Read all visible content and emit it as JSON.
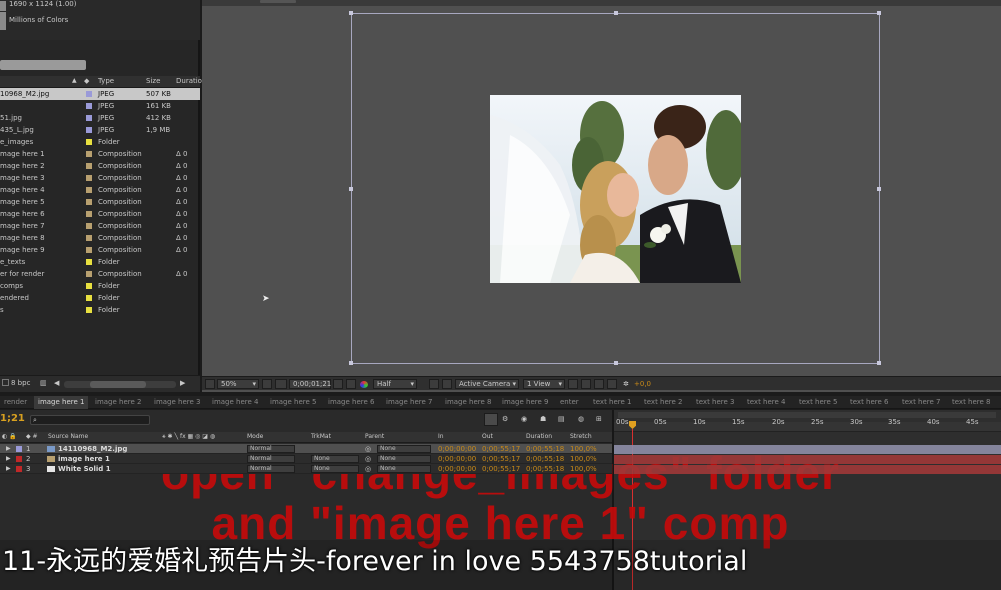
{
  "project": {
    "info": {
      "dimensions": "1690 x 1124 (1.00)",
      "colors": "Millions of Colors"
    },
    "columns": {
      "type": "Type",
      "size": "Size",
      "duration": "Duration"
    },
    "items": [
      {
        "name": "10968_M2.jpg",
        "type": "JPEG",
        "size": "507 KB",
        "duration": "",
        "color": "#9a9ad8",
        "selected": true
      },
      {
        "name": "",
        "type": "JPEG",
        "size": "161 KB",
        "duration": "",
        "color": "#9a9ad8"
      },
      {
        "name": "51.jpg",
        "type": "JPEG",
        "size": "412 KB",
        "duration": "",
        "color": "#9a9ad8"
      },
      {
        "name": "435_L.jpg",
        "type": "JPEG",
        "size": "1,9 MB",
        "duration": "",
        "color": "#9a9ad8"
      },
      {
        "name": "e_images",
        "type": "Folder",
        "size": "",
        "duration": "",
        "color": "#e8e040"
      },
      {
        "name": "mage here 1",
        "type": "Composition",
        "size": "",
        "duration": "Δ 0",
        "color": "#b8a070"
      },
      {
        "name": "mage here 2",
        "type": "Composition",
        "size": "",
        "duration": "Δ 0",
        "color": "#b8a070"
      },
      {
        "name": "mage here 3",
        "type": "Composition",
        "size": "",
        "duration": "Δ 0",
        "color": "#b8a070"
      },
      {
        "name": "mage here 4",
        "type": "Composition",
        "size": "",
        "duration": "Δ 0",
        "color": "#b8a070"
      },
      {
        "name": "mage here 5",
        "type": "Composition",
        "size": "",
        "duration": "Δ 0",
        "color": "#b8a070"
      },
      {
        "name": "mage here 6",
        "type": "Composition",
        "size": "",
        "duration": "Δ 0",
        "color": "#b8a070"
      },
      {
        "name": "mage here 7",
        "type": "Composition",
        "size": "",
        "duration": "Δ 0",
        "color": "#b8a070"
      },
      {
        "name": "mage here 8",
        "type": "Composition",
        "size": "",
        "duration": "Δ 0",
        "color": "#b8a070"
      },
      {
        "name": "mage here 9",
        "type": "Composition",
        "size": "",
        "duration": "Δ 0",
        "color": "#b8a070"
      },
      {
        "name": "e_texts",
        "type": "Folder",
        "size": "",
        "duration": "",
        "color": "#e8e040"
      },
      {
        "name": "er for render",
        "type": "Composition",
        "size": "",
        "duration": "Δ 0",
        "color": "#b8a070"
      },
      {
        "name": "comps",
        "type": "Folder",
        "size": "",
        "duration": "",
        "color": "#e8e040"
      },
      {
        "name": "endered",
        "type": "Folder",
        "size": "",
        "duration": "",
        "color": "#e8e040"
      },
      {
        "name": "s",
        "type": "Folder",
        "size": "",
        "duration": "",
        "color": "#e8e040"
      }
    ],
    "footer": {
      "bpc": "8 bpc"
    }
  },
  "viewer": {
    "zoom": "50%",
    "timecode": "0;00;01;21",
    "resolution": "Half",
    "camera": "Active Camera",
    "views": "1 View",
    "exposure": "+0,0"
  },
  "timeline": {
    "tabs": [
      "render",
      "image here 1",
      "image here 2",
      "image here 3",
      "image here 4",
      "image here 5",
      "image here 6",
      "image here 7",
      "image here 8",
      "image here 9",
      "enter",
      "text here 1",
      "text here 2",
      "text here 3",
      "text here 4",
      "text here 5",
      "text here 6",
      "text here 7",
      "text here 8"
    ],
    "active_tab": "image here 1",
    "current_time": "1;21",
    "columns": {
      "source_name": "Source Name",
      "mode": "Mode",
      "trkmat": "TrkMat",
      "parent": "Parent",
      "in": "In",
      "out": "Out",
      "duration": "Duration",
      "stretch": "Stretch"
    },
    "layers": [
      {
        "num": "1",
        "name": "14110968_M2.jpg",
        "mode": "Normal",
        "trkmat": "",
        "parent": "None",
        "in": "0;00;00;00",
        "out": "0;00;55;17",
        "duration": "0;00;55;18",
        "stretch": "100,0%",
        "color": "#9a9ad8"
      },
      {
        "num": "2",
        "name": "image here 1",
        "mode": "Normal",
        "trkmat": "None",
        "parent": "None",
        "in": "0;00;00;00",
        "out": "0;00;55;17",
        "duration": "0;00;55;18",
        "stretch": "100,0%",
        "color": "#c02828"
      },
      {
        "num": "3",
        "name": "White Solid 1",
        "mode": "Normal",
        "trkmat": "None",
        "parent": "None",
        "in": "0;00;00;00",
        "out": "0;00;55;17",
        "duration": "0;00;55;18",
        "stretch": "100,0%",
        "color": "#c02828"
      }
    ],
    "ruler": [
      "00s",
      "05s",
      "10s",
      "15s",
      "20s",
      "25s",
      "30s",
      "35s",
      "40s",
      "45s"
    ]
  },
  "overlay": {
    "line1": "open \"change_images\" folder",
    "line2": "and \"image here 1\" comp"
  },
  "caption": "11-永远的爱婚礼预告片头-forever in love 5543758tutorial"
}
